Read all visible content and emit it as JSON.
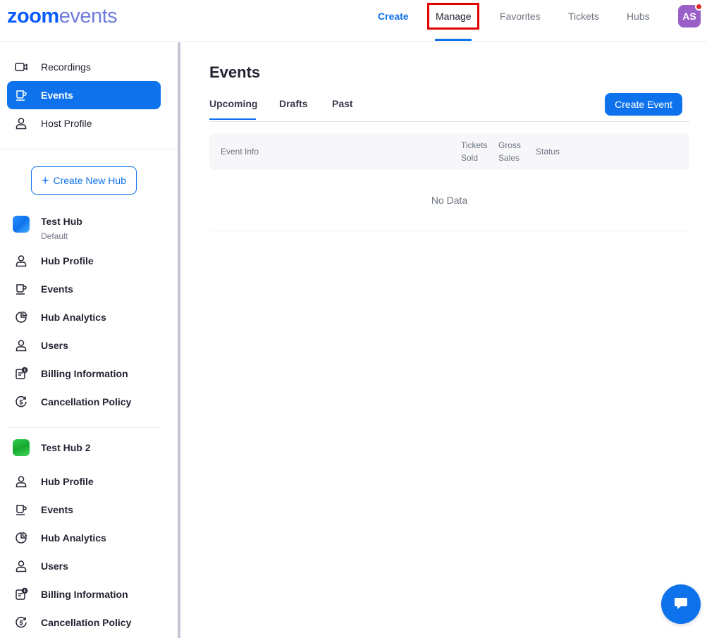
{
  "logo": {
    "bold": "zoom",
    "light": "events"
  },
  "nav": {
    "create": "Create",
    "manage": "Manage",
    "favorites": "Favorites",
    "tickets": "Tickets",
    "hubs": "Hubs"
  },
  "user": {
    "initials": "AS",
    "avatar_color": "#9b5fc8"
  },
  "sidebar": {
    "top_items": [
      {
        "label": "Recordings",
        "icon": "video-camera-icon"
      },
      {
        "label": "Events",
        "icon": "coffee-cup-icon",
        "selected": true
      },
      {
        "label": "Host Profile",
        "icon": "person-icon"
      }
    ],
    "create_hub_label": "Create New Hub",
    "hubs": [
      {
        "name": "Test Hub",
        "subtitle": "Default",
        "logo_color": "#0e72ed",
        "items": [
          "Hub Profile",
          "Events",
          "Hub Analytics",
          "Users",
          "Billing Information",
          "Cancellation Policy"
        ]
      },
      {
        "name": "Test Hub 2",
        "subtitle": "",
        "logo_color": "#1db93c",
        "items": [
          "Hub Profile",
          "Events",
          "Hub Analytics",
          "Users",
          "Billing Information",
          "Cancellation Policy"
        ]
      }
    ]
  },
  "main": {
    "title": "Events",
    "tabs": [
      "Upcoming",
      "Drafts",
      "Past"
    ],
    "create_event_label": "Create Event",
    "table": {
      "columns": {
        "event_info": "Event Info",
        "tickets_sold_1": "Tickets",
        "tickets_sold_2": "Sold",
        "gross_sales_1": "Gross",
        "gross_sales_2": "Sales",
        "status": "Status"
      },
      "empty_text": "No Data"
    }
  },
  "colors": {
    "accent": "#0e72ed",
    "highlight_box": "#e00000"
  }
}
